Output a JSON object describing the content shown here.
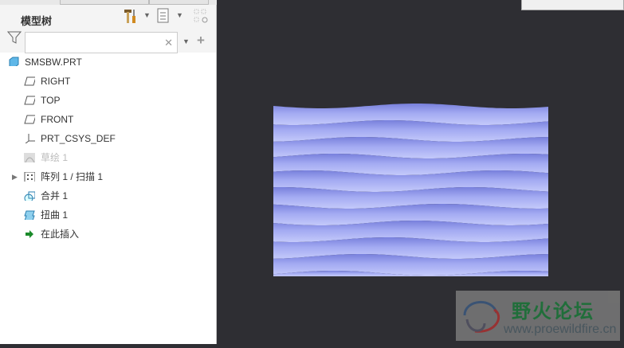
{
  "panel": {
    "title": "模型树",
    "search": {
      "value": "",
      "placeholder": ""
    }
  },
  "tree": [
    {
      "label": "SMSBW.PRT",
      "icon": "part-icon"
    },
    {
      "label": "RIGHT",
      "icon": "datum-plane-icon"
    },
    {
      "label": "TOP",
      "icon": "datum-plane-icon"
    },
    {
      "label": "FRONT",
      "icon": "datum-plane-icon"
    },
    {
      "label": "PRT_CSYS_DEF",
      "icon": "csys-icon"
    },
    {
      "label": "草绘 1",
      "icon": "sketch-icon"
    },
    {
      "label": "阵列 1 / 扫描 1",
      "icon": "pattern-icon"
    },
    {
      "label": "合并 1",
      "icon": "merge-icon"
    },
    {
      "label": "扭曲 1",
      "icon": "warp-icon"
    },
    {
      "label": "在此插入",
      "icon": "insert-here-icon"
    }
  ],
  "watermark": {
    "name": "野火论坛",
    "url": "www.proewildfire.cn"
  },
  "colors": {
    "viewport": "#2e2e33",
    "surface": "#a3aaf2",
    "surface_dark": "#7880dc"
  }
}
